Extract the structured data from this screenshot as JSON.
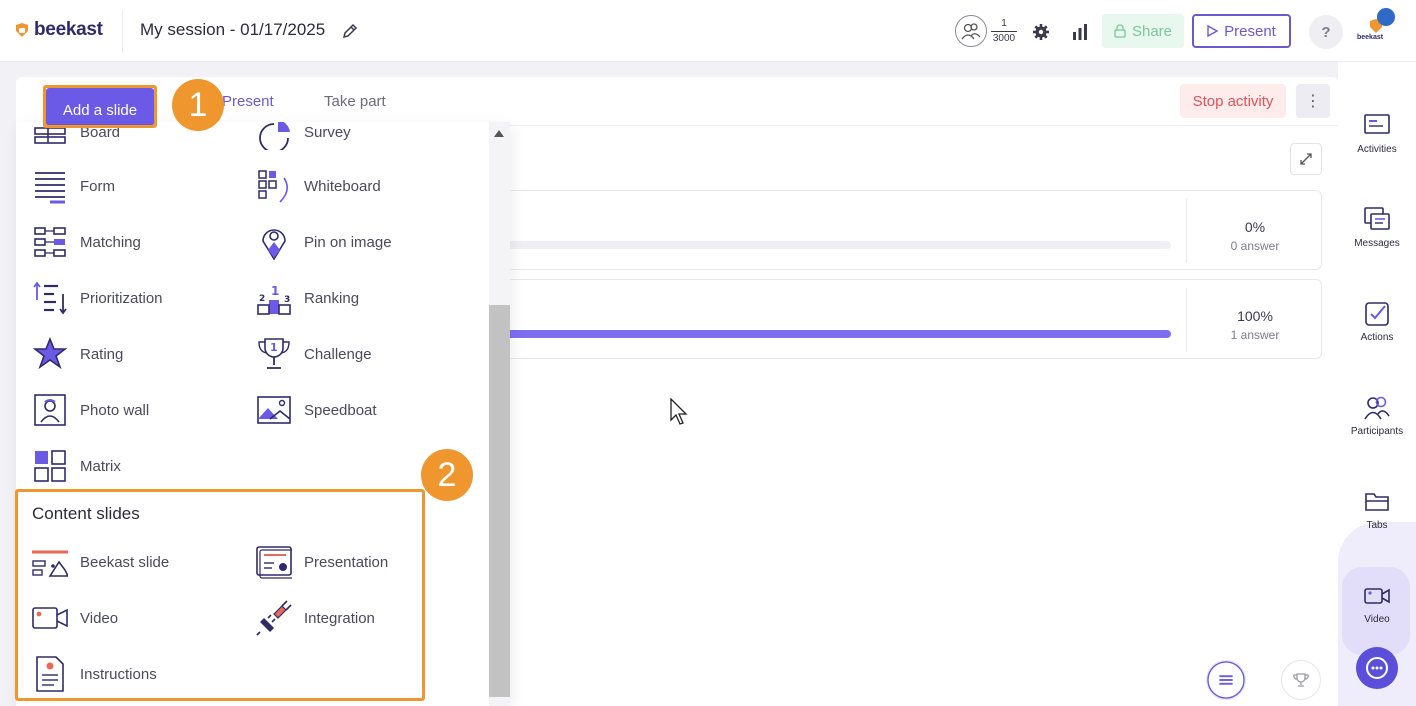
{
  "header": {
    "logo_text": "beekast",
    "session_title": "My session - 01/17/2025",
    "participants": {
      "current": "1",
      "max": "3000"
    },
    "share_label": "Share",
    "present_label": "Present",
    "help_label": "?",
    "account_label": "beekast"
  },
  "tabs": {
    "present": "Present",
    "take_part": "Take part",
    "stop_activity": "Stop activity"
  },
  "results": [
    {
      "percent_label": "0%",
      "answers": "0 answer",
      "fill": 0.0
    },
    {
      "percent_label": "100%",
      "answers": "1 answer",
      "fill": 1.0
    }
  ],
  "add_slide": {
    "button_label": "Add a slide",
    "activities_left": [
      "Board",
      "Form",
      "Matching",
      "Prioritization",
      "Rating",
      "Photo wall",
      "Matrix"
    ],
    "activities_right": [
      "Survey",
      "Whiteboard",
      "Pin on image",
      "Ranking",
      "Challenge",
      "Speedboat"
    ],
    "content_section_title": "Content slides",
    "content_left": [
      "Beekast slide",
      "Video",
      "Instructions"
    ],
    "content_right": [
      "Presentation",
      "Integration"
    ]
  },
  "sidebar": {
    "items": [
      {
        "label": "Activities",
        "icon": "activities-icon"
      },
      {
        "label": "Messages",
        "icon": "messages-icon"
      },
      {
        "label": "Actions",
        "icon": "actions-icon"
      },
      {
        "label": "Participants",
        "icon": "participants-icon"
      },
      {
        "label": "Tabs",
        "icon": "tabs-icon"
      },
      {
        "label": "Video",
        "icon": "video-icon"
      }
    ]
  },
  "annotations": {
    "step1": "1",
    "step2": "2"
  },
  "colors": {
    "accent": "#6a5ae6",
    "highlight": "#f0962e",
    "stop": "#e0535a",
    "share": "#7ac69a"
  }
}
